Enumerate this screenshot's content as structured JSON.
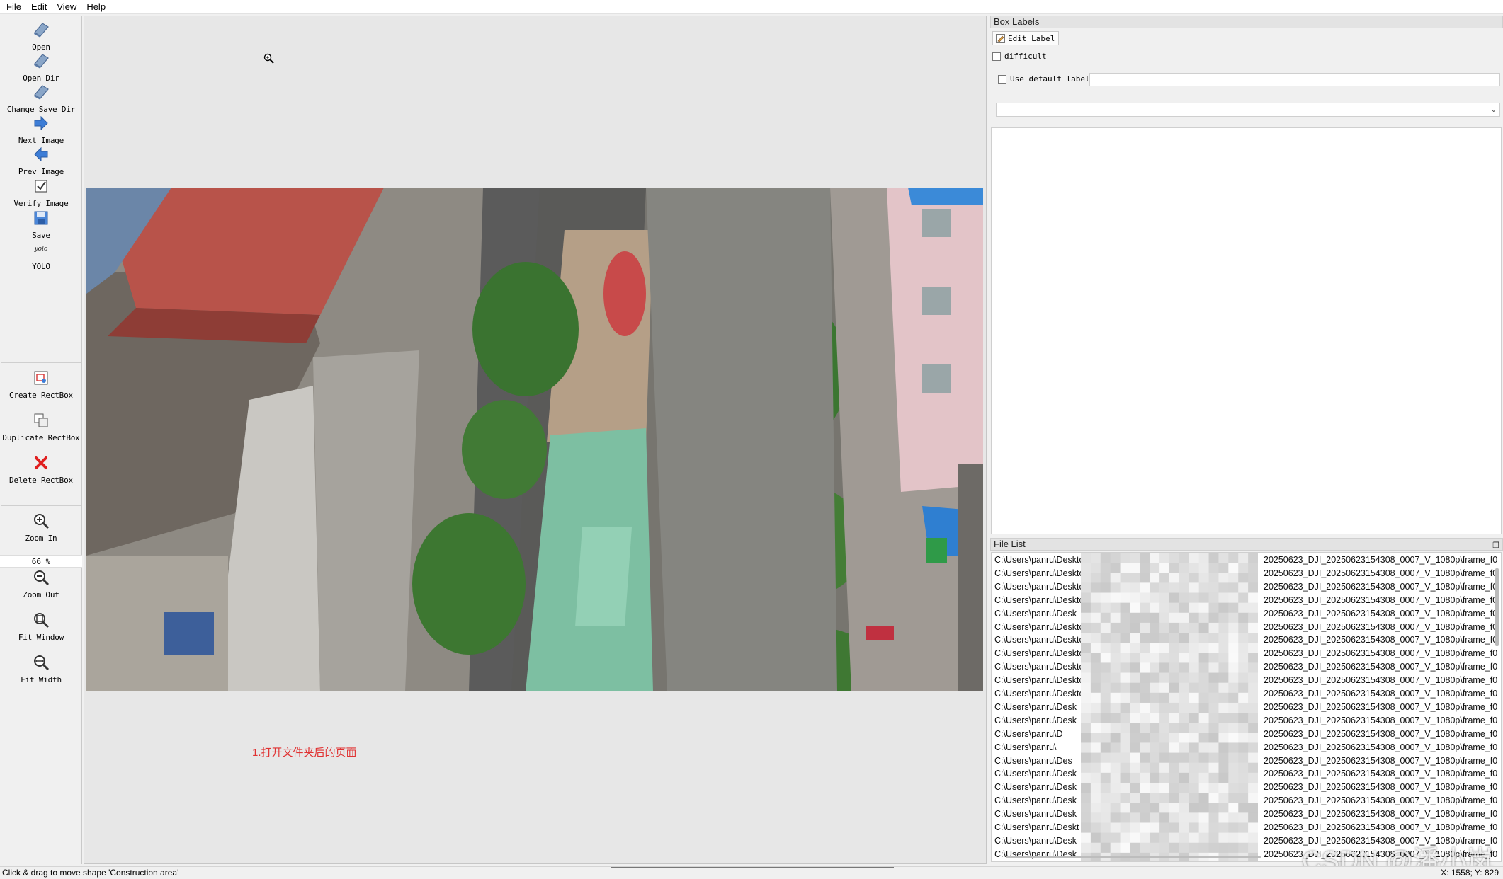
{
  "menu": [
    "File",
    "Edit",
    "View",
    "Help"
  ],
  "toolbar": {
    "tools": [
      {
        "label": "Open",
        "icon": "open-icon"
      },
      {
        "label": "Open Dir",
        "icon": "open-dir-icon"
      },
      {
        "label": "Change Save Dir",
        "icon": "change-save-dir-icon"
      },
      {
        "label": "Next Image",
        "icon": "next-arrow-icon"
      },
      {
        "label": "Prev Image",
        "icon": "prev-arrow-icon"
      },
      {
        "label": "Verify Image",
        "icon": "verify-check-icon"
      },
      {
        "label": "Save",
        "icon": "save-disk-icon"
      },
      {
        "label": "YOLO",
        "icon": "yolo-format-icon",
        "icon_text": "yolo"
      },
      {
        "label": "Create RectBox",
        "icon": "create-rectbox-icon"
      },
      {
        "label": "Duplicate RectBox",
        "icon": "duplicate-rectbox-icon"
      },
      {
        "label": "Delete RectBox",
        "icon": "delete-x-icon"
      },
      {
        "label": "Zoom In",
        "icon": "zoom-in-icon"
      },
      {
        "label": "Zoom Out",
        "icon": "zoom-out-icon"
      },
      {
        "label": "Fit Window",
        "icon": "fit-window-icon"
      },
      {
        "label": "Fit Width",
        "icon": "fit-width-icon"
      }
    ],
    "zoom": "66 %"
  },
  "canvas": {
    "caption": "1.打开文件夹后的页面"
  },
  "box_labels": {
    "title": "Box Labels",
    "edit_label": "Edit Label",
    "difficult": "difficult",
    "use_default": "Use default label"
  },
  "file_list": {
    "title": "File List",
    "rows": [
      {
        "path": "C:\\Users\\panru\\Deskto",
        "file": "20250623_DJI_20250623154308_0007_V_1080p\\frame_f0"
      },
      {
        "path": "C:\\Users\\panru\\Deskto",
        "file": "20250623_DJI_20250623154308_0007_V_1080p\\frame_f0"
      },
      {
        "path": "C:\\Users\\panru\\Deskto",
        "file": "20250623_DJI_20250623154308_0007_V_1080p\\frame_f0"
      },
      {
        "path": "C:\\Users\\panru\\Deskto",
        "file": "20250623_DJI_20250623154308_0007_V_1080p\\frame_f0"
      },
      {
        "path": "C:\\Users\\panru\\Desk",
        "file": "20250623_DJI_20250623154308_0007_V_1080p\\frame_f0"
      },
      {
        "path": "C:\\Users\\panru\\Deskto",
        "file": "20250623_DJI_20250623154308_0007_V_1080p\\frame_f0"
      },
      {
        "path": "C:\\Users\\panru\\Desktop",
        "file": "20250623_DJI_20250623154308_0007_V_1080p\\frame_f0"
      },
      {
        "path": "C:\\Users\\panru\\Deskto",
        "file": "20250623_DJI_20250623154308_0007_V_1080p\\frame_f0"
      },
      {
        "path": "C:\\Users\\panru\\Desktop",
        "file": "20250623_DJI_20250623154308_0007_V_1080p\\frame_f0"
      },
      {
        "path": "C:\\Users\\panru\\Desktop",
        "file": "20250623_DJI_20250623154308_0007_V_1080p\\frame_f0"
      },
      {
        "path": "C:\\Users\\panru\\Deskto",
        "file": "20250623_DJI_20250623154308_0007_V_1080p\\frame_f0"
      },
      {
        "path": "C:\\Users\\panru\\Desk",
        "file": "20250623_DJI_20250623154308_0007_V_1080p\\frame_f0"
      },
      {
        "path": "C:\\Users\\panru\\Desk",
        "file": "20250623_DJI_20250623154308_0007_V_1080p\\frame_f0"
      },
      {
        "path": "C:\\Users\\panru\\D",
        "file": "20250623_DJI_20250623154308_0007_V_1080p\\frame_f0"
      },
      {
        "path": "C:\\Users\\panru\\",
        "file": "20250623_DJI_20250623154308_0007_V_1080p\\frame_f0"
      },
      {
        "path": "C:\\Users\\panru\\Des",
        "file": "20250623_DJI_20250623154308_0007_V_1080p\\frame_f0"
      },
      {
        "path": "C:\\Users\\panru\\Desk",
        "file": "20250623_DJI_20250623154308_0007_V_1080p\\frame_f0"
      },
      {
        "path": "C:\\Users\\panru\\Desk",
        "file": "20250623_DJI_20250623154308_0007_V_1080p\\frame_f0"
      },
      {
        "path": "C:\\Users\\panru\\Desk",
        "file": "20250623_DJI_20250623154308_0007_V_1080p\\frame_f0"
      },
      {
        "path": "C:\\Users\\panru\\Desk",
        "file": "20250623_DJI_20250623154308_0007_V_1080p\\frame_f0"
      },
      {
        "path": "C:\\Users\\panru\\Deskt",
        "file": "20250623_DJI_20250623154308_0007_V_1080p\\frame_f0"
      },
      {
        "path": "C:\\Users\\panru\\Desk",
        "file": "20250623_DJI_20250623154308_0007_V_1080p\\frame_f0"
      },
      {
        "path": "C:\\Users\\panru\\Desk",
        "file": "20250623_DJI_20250623154308_0007_V_1080p\\frame_f0"
      }
    ]
  },
  "status": {
    "message": "Click & drag to move shape 'Construction area'",
    "coords": "X: 1558; Y: 829"
  },
  "watermark": "CSDN @潘小岚"
}
